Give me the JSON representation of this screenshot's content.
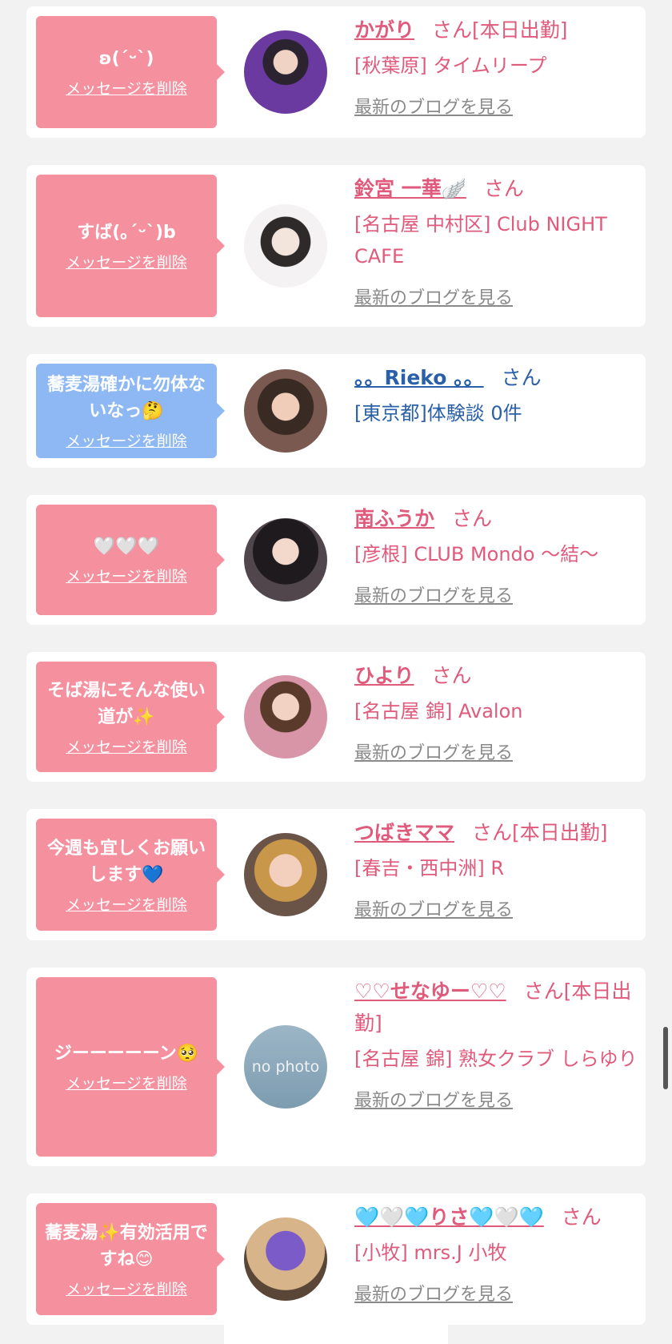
{
  "items": [
    {
      "message": "ʚ(ˊᵕˋ)",
      "delete_label": "メッセージを削除",
      "name": "かがり",
      "san": "さん",
      "status": "[本日出勤]",
      "shop": "[秋葉原] タイムリープ",
      "blog": "最新のブログを見る",
      "bubble_color": "#f5909f"
    },
    {
      "message": "すば(｡ˊᵕˋ)b",
      "delete_label": "メッセージを削除",
      "name": "鈴宮 一華🪽",
      "san": "さん",
      "status": "",
      "shop": "[名古屋 中村区] Club NIGHT CAFE",
      "blog": "最新のブログを見る",
      "bubble_color": "#f5909f"
    },
    {
      "message": "蕎麦湯確かに勿体ないなっ🤔",
      "delete_label": "メッセージを削除",
      "name": "。。Rieko 。。",
      "san": "さん",
      "status": "",
      "shop": "[東京都]体験談 0件",
      "blog": "",
      "bubble_color": "#8db8f3"
    },
    {
      "message": "🤍🤍🤍",
      "delete_label": "メッセージを削除",
      "name": "南ふうか",
      "san": "さん",
      "status": "",
      "shop": "[彦根] CLUB Mondo 〜結〜",
      "blog": "最新のブログを見る",
      "bubble_color": "#f5909f"
    },
    {
      "message": "そば湯にそんな使い道が✨",
      "delete_label": "メッセージを削除",
      "name": "ひより",
      "san": "さん",
      "status": "",
      "shop": "[名古屋 錦] Avalon",
      "blog": "最新のブログを見る",
      "bubble_color": "#f5909f"
    },
    {
      "message": "今週も宜しくお願いします💙",
      "delete_label": "メッセージを削除",
      "name": "つばきママ",
      "san": "さん",
      "status": "[本日出勤]",
      "shop": "[春吉・西中洲] R",
      "blog": "最新のブログを見る",
      "bubble_color": "#f5909f"
    },
    {
      "message": "ジーーーーーン🥺",
      "delete_label": "メッセージを削除",
      "name": "♡♡せなゆー♡♡",
      "san": "さん",
      "status": "[本日出勤]",
      "shop": "[名古屋 錦] 熟女クラブ しらゆり",
      "blog": "最新のブログを見る",
      "bubble_color": "#f5909f",
      "avatar_text": "no photo"
    },
    {
      "message": "蕎麦湯✨有効活用ですね😊",
      "delete_label": "メッセージを削除",
      "name": "🩵🤍🩵りさ🩵🤍🩵",
      "san": "さん",
      "status": "",
      "shop": "[小牧] mrs.J 小牧",
      "blog": "最新のブログを見る",
      "bubble_color": "#f5909f"
    }
  ],
  "colors": {
    "accent": "#e05a7c",
    "link_blue": "#2a60a8",
    "muted": "#8a8a8a"
  }
}
